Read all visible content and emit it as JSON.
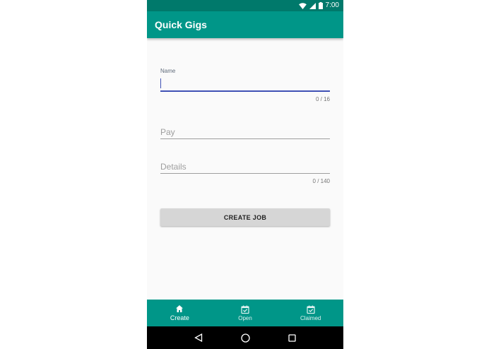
{
  "status_bar": {
    "time": "7:00"
  },
  "app_bar": {
    "title": "Quick Gigs"
  },
  "form": {
    "name": {
      "label": "Name",
      "value": "",
      "counter": "0 / 16"
    },
    "pay": {
      "placeholder": "Pay",
      "value": ""
    },
    "details": {
      "placeholder": "Details",
      "value": "",
      "counter": "0 / 140"
    },
    "submit_label": "CREATE JOB"
  },
  "bottom_nav": {
    "items": [
      {
        "label": "Create",
        "icon": "home-icon",
        "active": true
      },
      {
        "label": "Open",
        "icon": "calendar-check-icon",
        "active": false
      },
      {
        "label": "Claimed",
        "icon": "calendar-check-icon",
        "active": false
      }
    ]
  },
  "system_nav": {
    "icons": [
      "back-icon",
      "home-circle-icon",
      "recents-icon"
    ]
  },
  "colors": {
    "primary": "#009688",
    "primary_dark": "#00796b",
    "accent": "#3f51b5",
    "background": "#fafafa",
    "button": "#d6d6d6"
  }
}
